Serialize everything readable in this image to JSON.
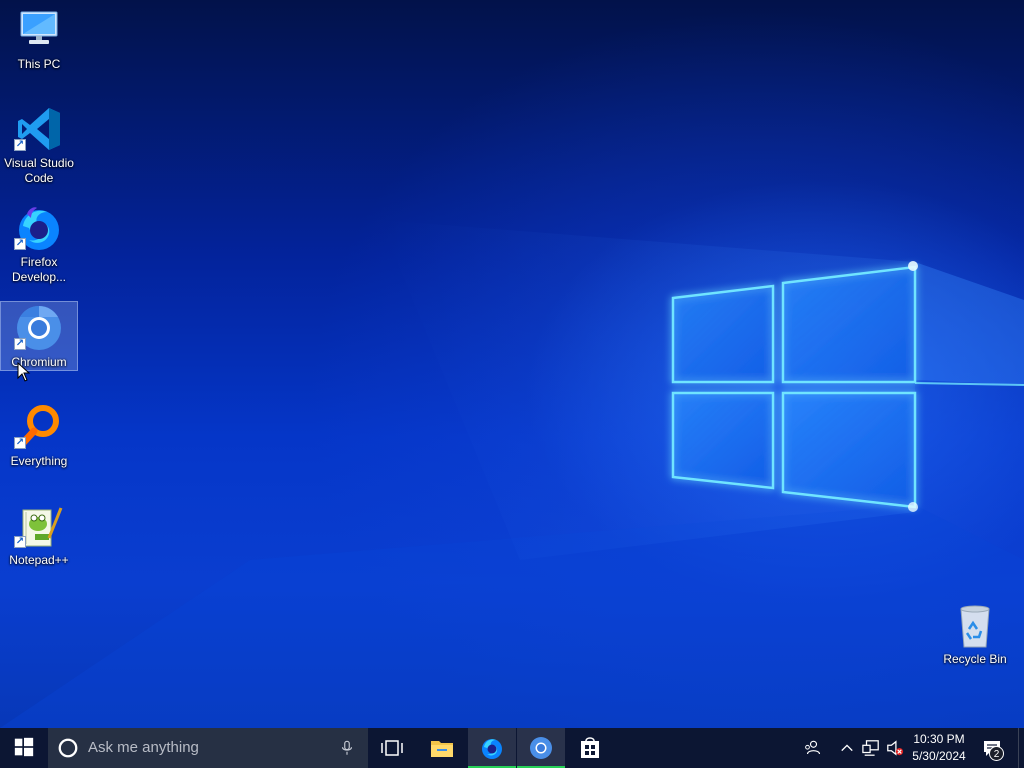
{
  "desktop": {
    "icons": [
      {
        "id": "this-pc",
        "label": "This PC",
        "icon": "computer-icon",
        "shortcut": false,
        "selected": false
      },
      {
        "id": "vscode",
        "label": "Visual Studio Code",
        "icon": "vscode-icon",
        "shortcut": true,
        "selected": false
      },
      {
        "id": "firefox-dev",
        "label": "Firefox Develop...",
        "icon": "firefox-developer-icon",
        "shortcut": true,
        "selected": false
      },
      {
        "id": "chromium",
        "label": "Chromium",
        "icon": "chromium-icon",
        "shortcut": true,
        "selected": true
      },
      {
        "id": "everything",
        "label": "Everything",
        "icon": "everything-search-icon",
        "shortcut": true,
        "selected": false
      },
      {
        "id": "notepadpp",
        "label": "Notepad++",
        "icon": "notepad-plus-plus-icon",
        "shortcut": true,
        "selected": false
      },
      {
        "id": "recycle-bin",
        "label": "Recycle Bin",
        "icon": "recycle-bin-icon",
        "shortcut": false,
        "selected": false
      }
    ]
  },
  "taskbar": {
    "search_placeholder": "Ask me anything",
    "pinned": [
      {
        "id": "task-view",
        "icon": "task-view-icon",
        "active": false
      },
      {
        "id": "file-explorer",
        "icon": "folder-icon",
        "active": false
      },
      {
        "id": "firefox-dev",
        "icon": "firefox-developer-icon",
        "active": true
      },
      {
        "id": "chromium",
        "icon": "chromium-icon",
        "active": true
      },
      {
        "id": "store",
        "icon": "store-icon",
        "active": false
      }
    ],
    "tray": {
      "time": "10:30 PM",
      "date": "5/30/2024",
      "notification_count": "2",
      "icons": [
        "people-icon",
        "chevron-up-icon",
        "network-icon",
        "volume-muted-icon",
        "action-center-icon"
      ]
    }
  },
  "colors": {
    "taskbar_bg": "#0c1633",
    "search_bg": "#263044",
    "active_indicator": "#27d157",
    "wallpaper_accent": "#3fb8ff"
  }
}
